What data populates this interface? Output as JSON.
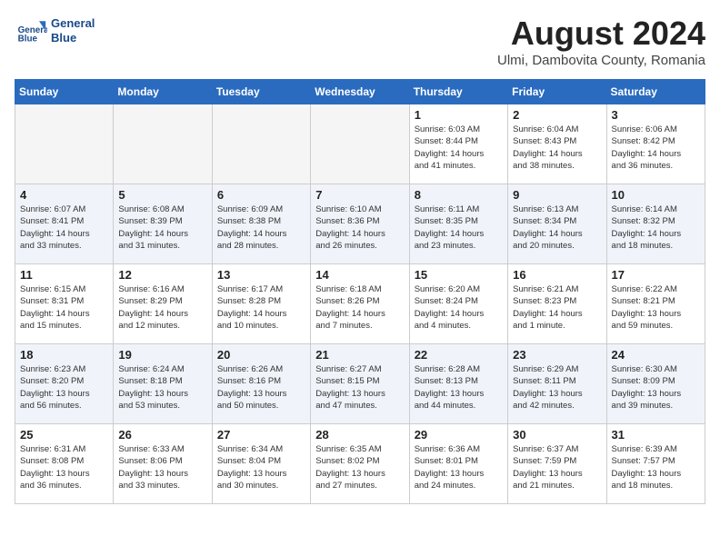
{
  "header": {
    "logo_line1": "General",
    "logo_line2": "Blue",
    "month": "August 2024",
    "location": "Ulmi, Dambovita County, Romania"
  },
  "weekdays": [
    "Sunday",
    "Monday",
    "Tuesday",
    "Wednesday",
    "Thursday",
    "Friday",
    "Saturday"
  ],
  "weeks": [
    [
      {
        "day": "",
        "info": ""
      },
      {
        "day": "",
        "info": ""
      },
      {
        "day": "",
        "info": ""
      },
      {
        "day": "",
        "info": ""
      },
      {
        "day": "1",
        "info": "Sunrise: 6:03 AM\nSunset: 8:44 PM\nDaylight: 14 hours\nand 41 minutes."
      },
      {
        "day": "2",
        "info": "Sunrise: 6:04 AM\nSunset: 8:43 PM\nDaylight: 14 hours\nand 38 minutes."
      },
      {
        "day": "3",
        "info": "Sunrise: 6:06 AM\nSunset: 8:42 PM\nDaylight: 14 hours\nand 36 minutes."
      }
    ],
    [
      {
        "day": "4",
        "info": "Sunrise: 6:07 AM\nSunset: 8:41 PM\nDaylight: 14 hours\nand 33 minutes."
      },
      {
        "day": "5",
        "info": "Sunrise: 6:08 AM\nSunset: 8:39 PM\nDaylight: 14 hours\nand 31 minutes."
      },
      {
        "day": "6",
        "info": "Sunrise: 6:09 AM\nSunset: 8:38 PM\nDaylight: 14 hours\nand 28 minutes."
      },
      {
        "day": "7",
        "info": "Sunrise: 6:10 AM\nSunset: 8:36 PM\nDaylight: 14 hours\nand 26 minutes."
      },
      {
        "day": "8",
        "info": "Sunrise: 6:11 AM\nSunset: 8:35 PM\nDaylight: 14 hours\nand 23 minutes."
      },
      {
        "day": "9",
        "info": "Sunrise: 6:13 AM\nSunset: 8:34 PM\nDaylight: 14 hours\nand 20 minutes."
      },
      {
        "day": "10",
        "info": "Sunrise: 6:14 AM\nSunset: 8:32 PM\nDaylight: 14 hours\nand 18 minutes."
      }
    ],
    [
      {
        "day": "11",
        "info": "Sunrise: 6:15 AM\nSunset: 8:31 PM\nDaylight: 14 hours\nand 15 minutes."
      },
      {
        "day": "12",
        "info": "Sunrise: 6:16 AM\nSunset: 8:29 PM\nDaylight: 14 hours\nand 12 minutes."
      },
      {
        "day": "13",
        "info": "Sunrise: 6:17 AM\nSunset: 8:28 PM\nDaylight: 14 hours\nand 10 minutes."
      },
      {
        "day": "14",
        "info": "Sunrise: 6:18 AM\nSunset: 8:26 PM\nDaylight: 14 hours\nand 7 minutes."
      },
      {
        "day": "15",
        "info": "Sunrise: 6:20 AM\nSunset: 8:24 PM\nDaylight: 14 hours\nand 4 minutes."
      },
      {
        "day": "16",
        "info": "Sunrise: 6:21 AM\nSunset: 8:23 PM\nDaylight: 14 hours\nand 1 minute."
      },
      {
        "day": "17",
        "info": "Sunrise: 6:22 AM\nSunset: 8:21 PM\nDaylight: 13 hours\nand 59 minutes."
      }
    ],
    [
      {
        "day": "18",
        "info": "Sunrise: 6:23 AM\nSunset: 8:20 PM\nDaylight: 13 hours\nand 56 minutes."
      },
      {
        "day": "19",
        "info": "Sunrise: 6:24 AM\nSunset: 8:18 PM\nDaylight: 13 hours\nand 53 minutes."
      },
      {
        "day": "20",
        "info": "Sunrise: 6:26 AM\nSunset: 8:16 PM\nDaylight: 13 hours\nand 50 minutes."
      },
      {
        "day": "21",
        "info": "Sunrise: 6:27 AM\nSunset: 8:15 PM\nDaylight: 13 hours\nand 47 minutes."
      },
      {
        "day": "22",
        "info": "Sunrise: 6:28 AM\nSunset: 8:13 PM\nDaylight: 13 hours\nand 44 minutes."
      },
      {
        "day": "23",
        "info": "Sunrise: 6:29 AM\nSunset: 8:11 PM\nDaylight: 13 hours\nand 42 minutes."
      },
      {
        "day": "24",
        "info": "Sunrise: 6:30 AM\nSunset: 8:09 PM\nDaylight: 13 hours\nand 39 minutes."
      }
    ],
    [
      {
        "day": "25",
        "info": "Sunrise: 6:31 AM\nSunset: 8:08 PM\nDaylight: 13 hours\nand 36 minutes."
      },
      {
        "day": "26",
        "info": "Sunrise: 6:33 AM\nSunset: 8:06 PM\nDaylight: 13 hours\nand 33 minutes."
      },
      {
        "day": "27",
        "info": "Sunrise: 6:34 AM\nSunset: 8:04 PM\nDaylight: 13 hours\nand 30 minutes."
      },
      {
        "day": "28",
        "info": "Sunrise: 6:35 AM\nSunset: 8:02 PM\nDaylight: 13 hours\nand 27 minutes."
      },
      {
        "day": "29",
        "info": "Sunrise: 6:36 AM\nSunset: 8:01 PM\nDaylight: 13 hours\nand 24 minutes."
      },
      {
        "day": "30",
        "info": "Sunrise: 6:37 AM\nSunset: 7:59 PM\nDaylight: 13 hours\nand 21 minutes."
      },
      {
        "day": "31",
        "info": "Sunrise: 6:39 AM\nSunset: 7:57 PM\nDaylight: 13 hours\nand 18 minutes."
      }
    ]
  ]
}
